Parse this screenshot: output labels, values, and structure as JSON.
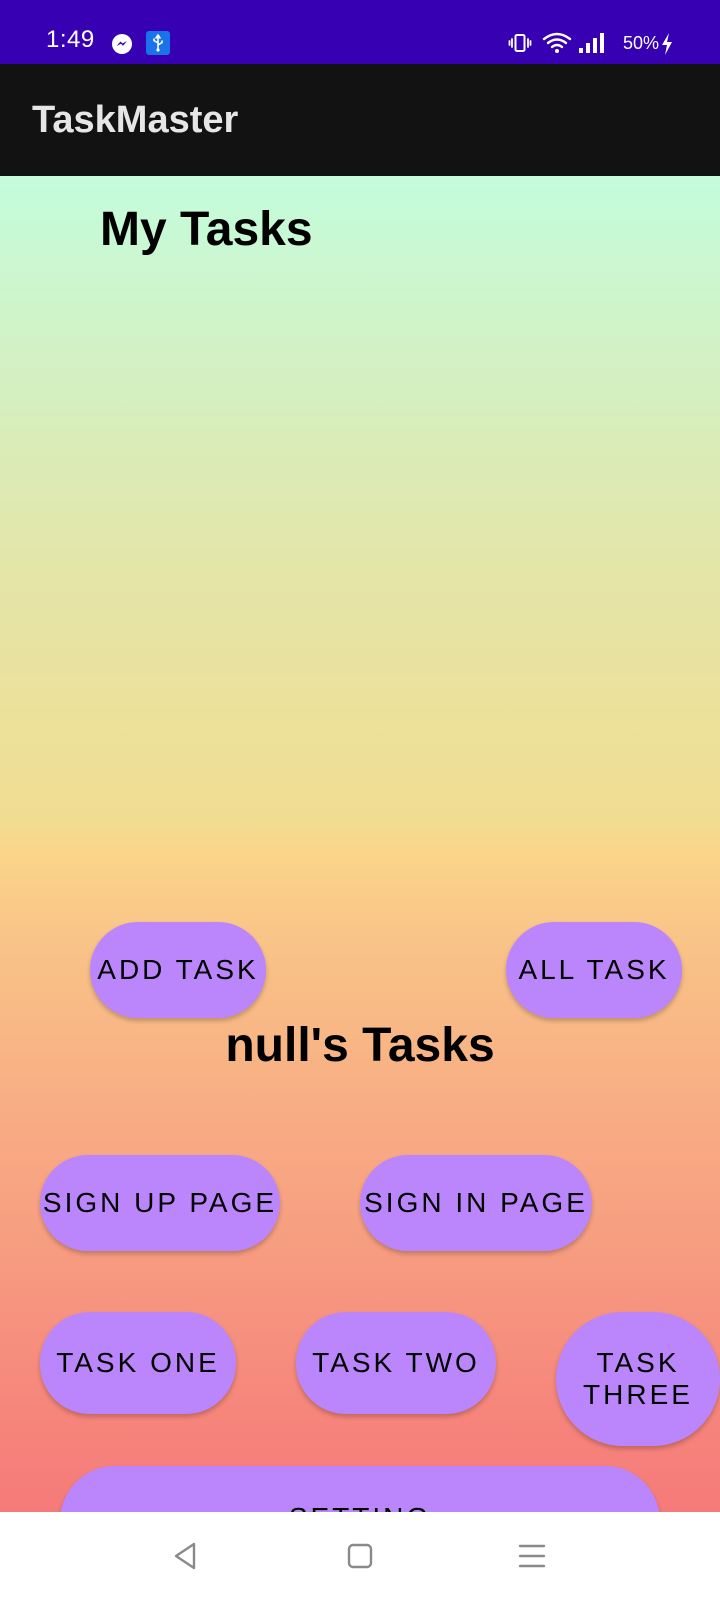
{
  "status_bar": {
    "time": "1:49",
    "battery": "50%",
    "icons": [
      "messenger-icon",
      "usb-icon",
      "vibrate-icon",
      "wifi-icon",
      "signal-icon",
      "charging-icon"
    ],
    "background": "#3700b3"
  },
  "app_bar": {
    "title": "TaskMaster",
    "background": "#121212"
  },
  "main": {
    "heading": "My Tasks",
    "user_heading": "null's Tasks",
    "buttons": {
      "add_task": "ADD TASK",
      "all_task": "ALL TASK",
      "sign_up": "SIGN UP PAGE",
      "sign_in": "SIGN IN PAGE",
      "task_one": "TASK ONE",
      "task_two": "TASK TWO",
      "task_three_line1": "TASK",
      "task_three_line2": "THREE",
      "setting": "SETTING"
    },
    "button_color": "#bb86fc",
    "gradient": [
      "#c4fcdc",
      "#fbd489",
      "#f67a7a"
    ]
  },
  "nav_bar": {
    "buttons": [
      "back-icon",
      "home-icon",
      "recents-icon"
    ]
  }
}
